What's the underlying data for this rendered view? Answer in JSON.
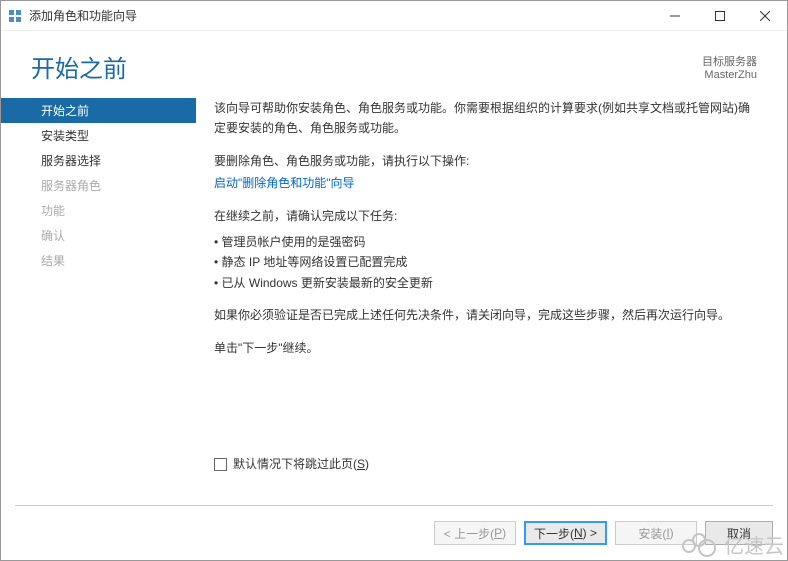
{
  "window": {
    "title": "添加角色和功能向导"
  },
  "header": {
    "page_title": "开始之前",
    "target_label": "目标服务器",
    "target_name": "MasterZhu"
  },
  "sidebar": {
    "items": [
      {
        "label": "开始之前",
        "state": "active"
      },
      {
        "label": "安装类型",
        "state": "enabled"
      },
      {
        "label": "服务器选择",
        "state": "enabled"
      },
      {
        "label": "服务器角色",
        "state": "disabled"
      },
      {
        "label": "功能",
        "state": "disabled"
      },
      {
        "label": "确认",
        "state": "disabled"
      },
      {
        "label": "结果",
        "state": "disabled"
      }
    ]
  },
  "content": {
    "intro": "该向导可帮助你安装角色、角色服务或功能。你需要根据组织的计算要求(例如共享文档或托管网站)确定要安装的角色、角色服务或功能。",
    "remove_hint": "要删除角色、角色服务或功能，请执行以下操作:",
    "remove_link": "启动\"删除角色和功能\"向导",
    "tasks_hint": "在继续之前，请确认完成以下任务:",
    "tasks": [
      "管理员帐户使用的是强密码",
      "静态 IP 地址等网络设置已配置完成",
      "已从 Windows 更新安装最新的安全更新"
    ],
    "verify": "如果你必须验证是否已完成上述任何先决条件，请关闭向导，完成这些步骤，然后再次运行向导。",
    "next_hint": "单击\"下一步\"继续。",
    "skip_label_pre": "默认情况下将跳过此页(",
    "skip_key": "S",
    "skip_label_post": ")"
  },
  "footer": {
    "prev_pre": "< 上一步(",
    "prev_key": "P",
    "prev_post": ")",
    "next_pre": "下一步(",
    "next_key": "N",
    "next_post": ") >",
    "install_pre": "安装(",
    "install_key": "I",
    "install_post": ")",
    "cancel": "取消"
  },
  "watermark": "亿速云"
}
